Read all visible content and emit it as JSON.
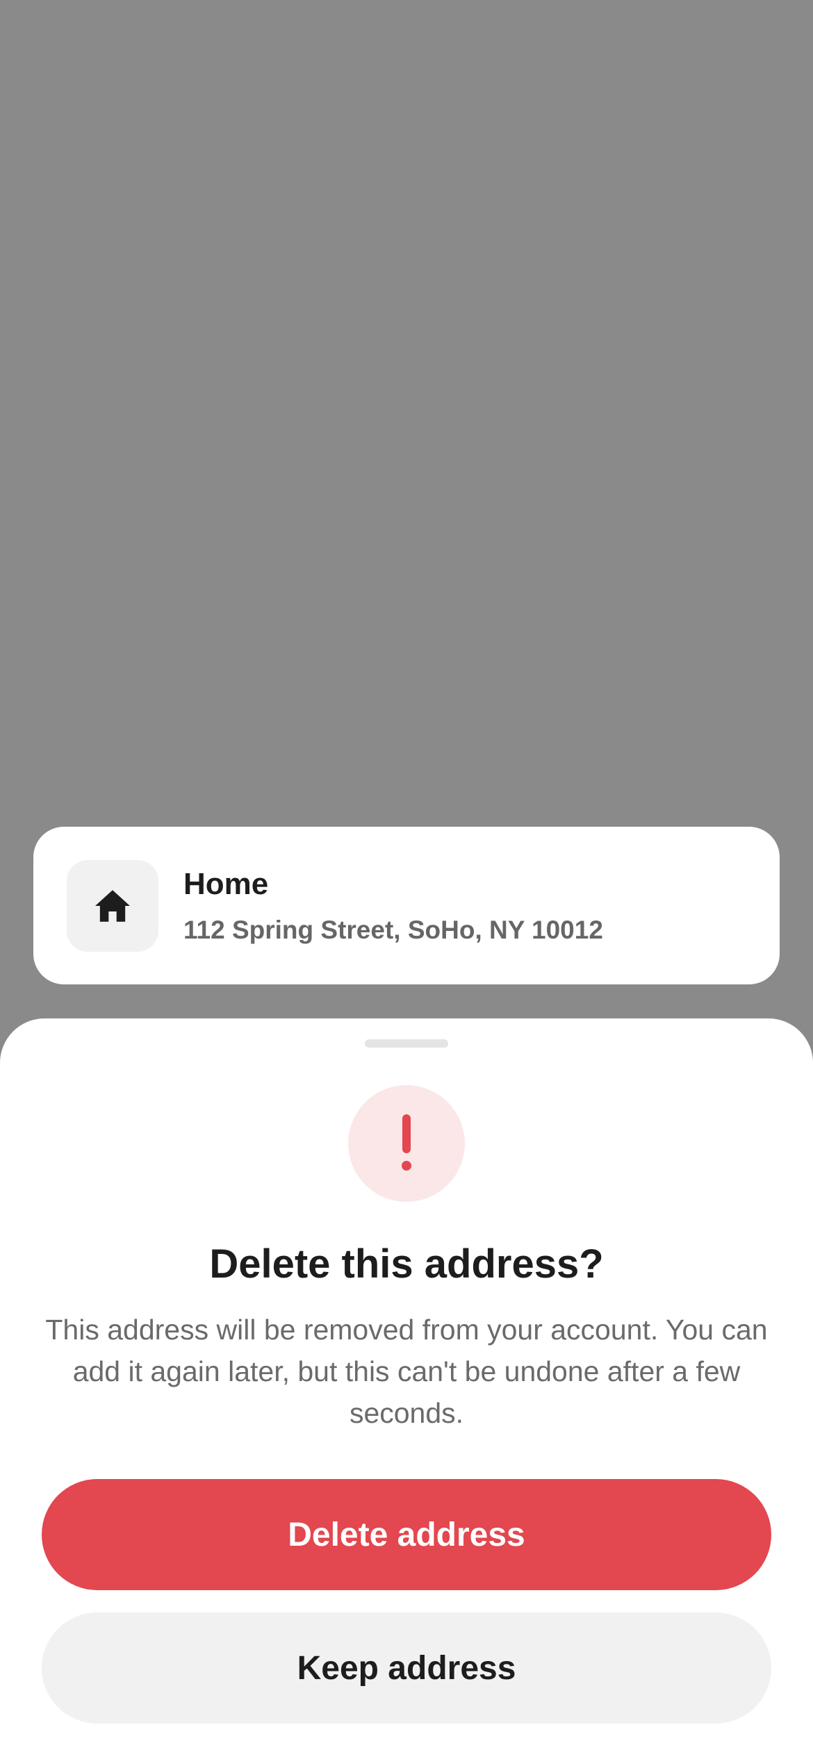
{
  "address_card": {
    "icon": "home-icon",
    "title": "Home",
    "address": "112 Spring Street, SoHo, NY 10012"
  },
  "sheet": {
    "warning_icon": "exclamation-icon",
    "title": "Delete this address?",
    "body": "This address will be removed from your account. You can add it again later, but this can't be undone after a few seconds.",
    "primary_button": "Delete address",
    "secondary_button": "Keep address"
  },
  "colors": {
    "backdrop": "#8a8a8a",
    "danger": "#e3474f",
    "danger_tint": "#fbe7e8",
    "secondary_button": "#f1f1f1",
    "text_primary": "#1d1d1d",
    "text_secondary": "#6a6a6a"
  }
}
